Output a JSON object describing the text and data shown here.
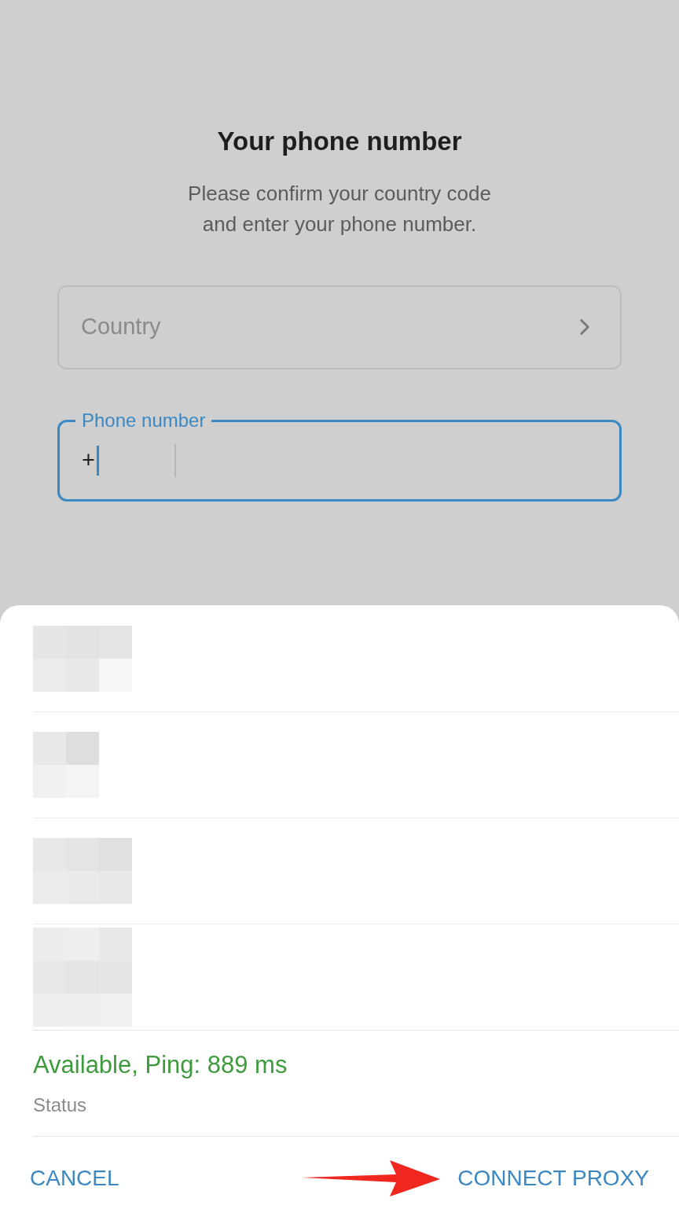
{
  "title": "Your phone number",
  "subtitle": "Please confirm your country code and enter your phone number.",
  "country_field": {
    "placeholder": "Country"
  },
  "phone_field": {
    "label": "Phone number",
    "code": "+",
    "focused": true
  },
  "proxy_sheet": {
    "status": {
      "value": "Available, Ping: 889 ms",
      "label": "Status",
      "available": true
    },
    "buttons": [
      {
        "label": "CANCEL"
      },
      {
        "label": "CONNECT PROXY"
      }
    ]
  }
}
